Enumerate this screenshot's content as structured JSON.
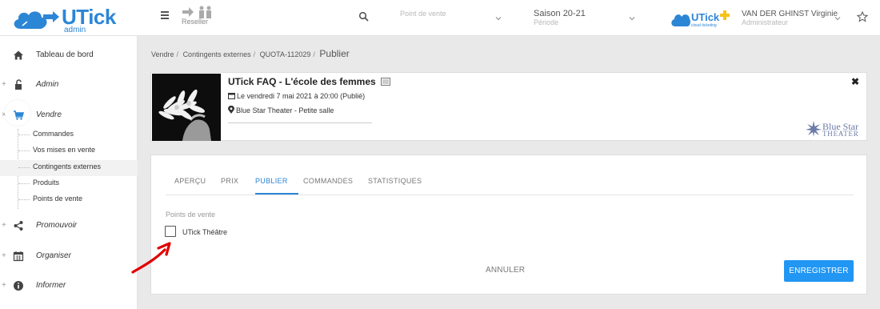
{
  "header": {
    "logo_text": "UTick",
    "logo_sub": "admin",
    "reseller_label": "Reseller",
    "point_de_vente_placeholder": "Point de vente",
    "saison": "Saison 20-21",
    "periode": "Période",
    "brand_logo_text": "UTick",
    "brand_logo_sub": "cloud ticketing",
    "user_name": "VAN DER GHINST Virginie",
    "user_role": "Administrateur"
  },
  "sidebar": {
    "items": [
      {
        "label": "Tableau de bord",
        "icon": "home-icon",
        "prefix": ""
      },
      {
        "label": "Admin",
        "icon": "lock-icon",
        "prefix": "+"
      },
      {
        "label": "Vendre",
        "icon": "cart-icon",
        "prefix": "×"
      },
      {
        "label": "Promouvoir",
        "icon": "share-icon",
        "prefix": "+"
      },
      {
        "label": "Organiser",
        "icon": "calendar-icon",
        "prefix": "+"
      },
      {
        "label": "Informer",
        "icon": "info-icon",
        "prefix": "+"
      }
    ],
    "vendre_sub": [
      "Commandes",
      "Vos mises en vente",
      "Contingents externes",
      "Produits",
      "Points de vente"
    ],
    "active_sub_index": 2
  },
  "breadcrumb": {
    "items": [
      "Vendre",
      "Contingents externes",
      "QUOTA-112029"
    ],
    "current": "Publier"
  },
  "event": {
    "title": "UTick FAQ - L'école des femmes",
    "date_line": "Le vendredi 7 mai 2021 à 20:00 (Publié)",
    "venue_line": "Blue Star Theater - Petite salle",
    "organizer_logo_line1": "Blue Star",
    "organizer_logo_line2": "THEATER"
  },
  "tabs": {
    "items": [
      "APERÇU",
      "PRIX",
      "PUBLIER",
      "COMMANDES",
      "STATISTIQUES"
    ],
    "active": "PUBLIER"
  },
  "form": {
    "section_label": "Points de vente",
    "checkbox_label": "UTick Théâtre",
    "checked": false
  },
  "actions": {
    "cancel": "ANNULER",
    "save": "ENREGISTRER"
  },
  "colors": {
    "accent": "#2c86d6",
    "button": "#2196f3",
    "annotation": "#e00000"
  }
}
